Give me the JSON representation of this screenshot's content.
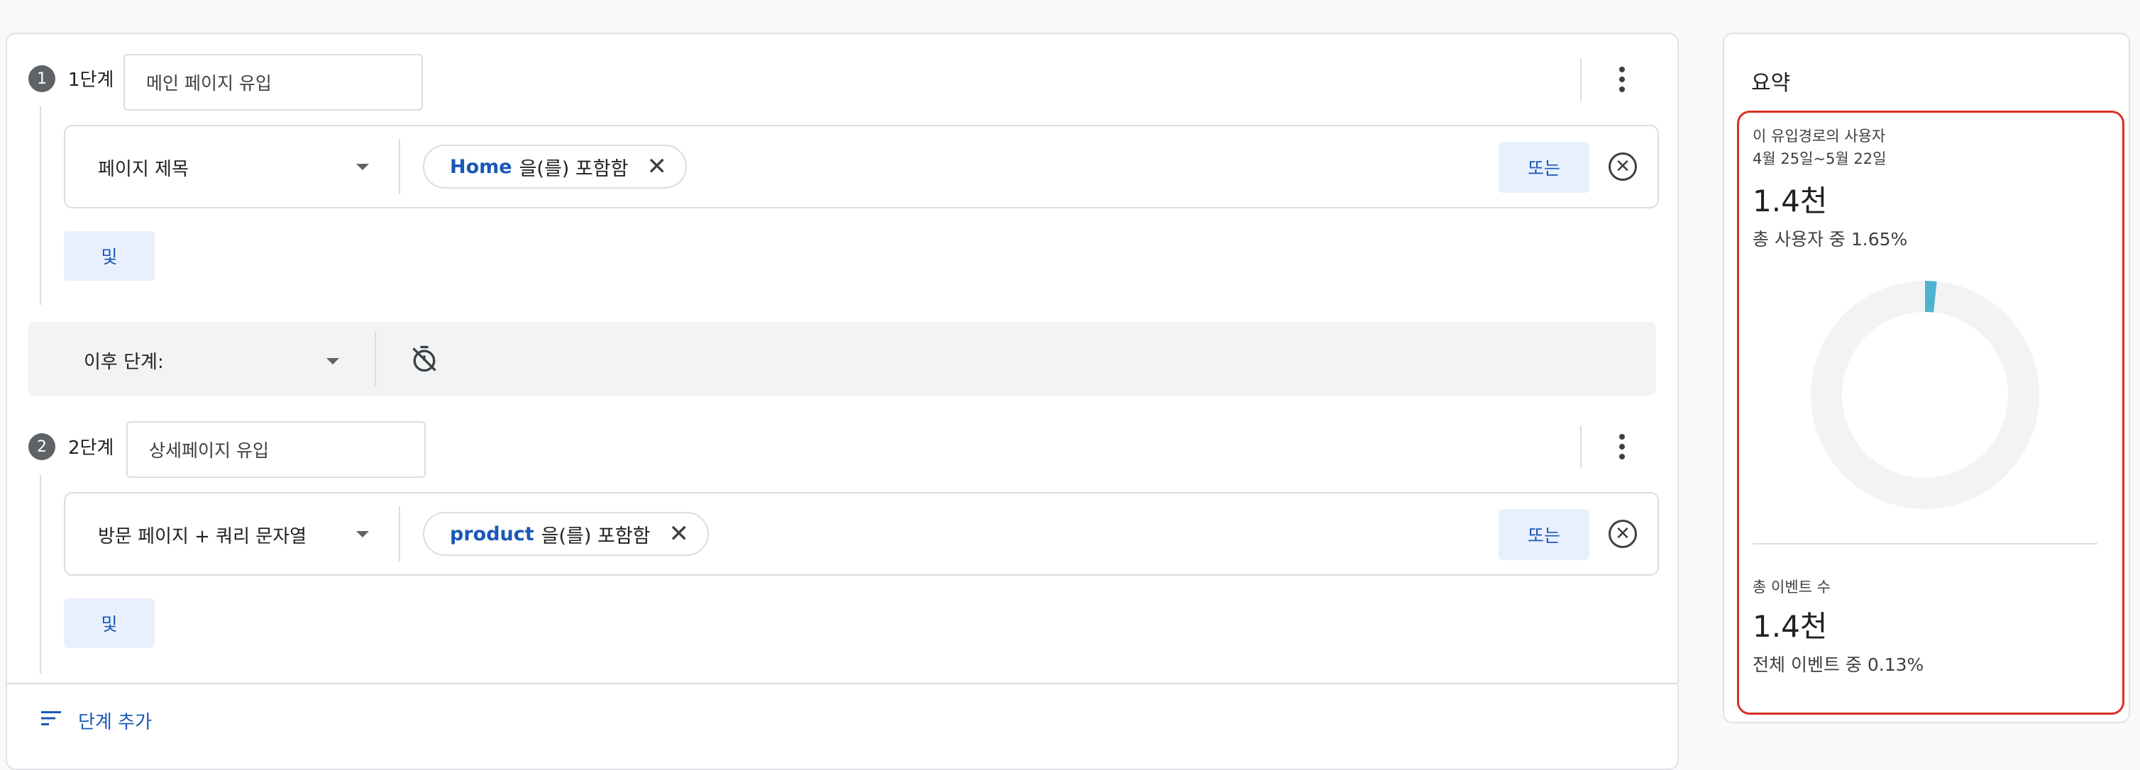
{
  "steps": [
    {
      "label": "1단계",
      "number": "1",
      "name": "메인 페이지 유입",
      "dimension": "페이지 제목",
      "chip_value": "Home",
      "chip_operator": "을(를) 포함함",
      "or_label": "또는",
      "and_label": "및"
    },
    {
      "label": "2단계",
      "number": "2",
      "name": "상세페이지 유입",
      "dimension": "방문 페이지 + 쿼리 문자열",
      "chip_value": "product",
      "chip_operator": "을(를) 포함함",
      "or_label": "또는",
      "and_label": "및"
    }
  ],
  "next_step": {
    "label": "이후 단계:"
  },
  "add_step_label": "단계 추가",
  "summary": {
    "title": "요약",
    "users_label": "이 유입경로의 사용자",
    "date_range": "4월 25일~5월 22일",
    "users_value": "1.4천",
    "users_pct": "총 사용자 중 1.65%",
    "users_fraction": 0.0165,
    "events_label": "총 이벤트 수",
    "events_value": "1.4천",
    "events_pct": "전체 이벤트 중 0.13%"
  },
  "colors": {
    "accent_blue": "#1a57b6",
    "donut_fill": "#4fb3cf",
    "donut_track": "#f1f3f4",
    "highlight_red": "#d93025"
  },
  "icons": {
    "more": "kebab-vertical",
    "timer_off": "timer-off",
    "close": "x",
    "remove": "circle-x",
    "sort": "sort-lines"
  }
}
